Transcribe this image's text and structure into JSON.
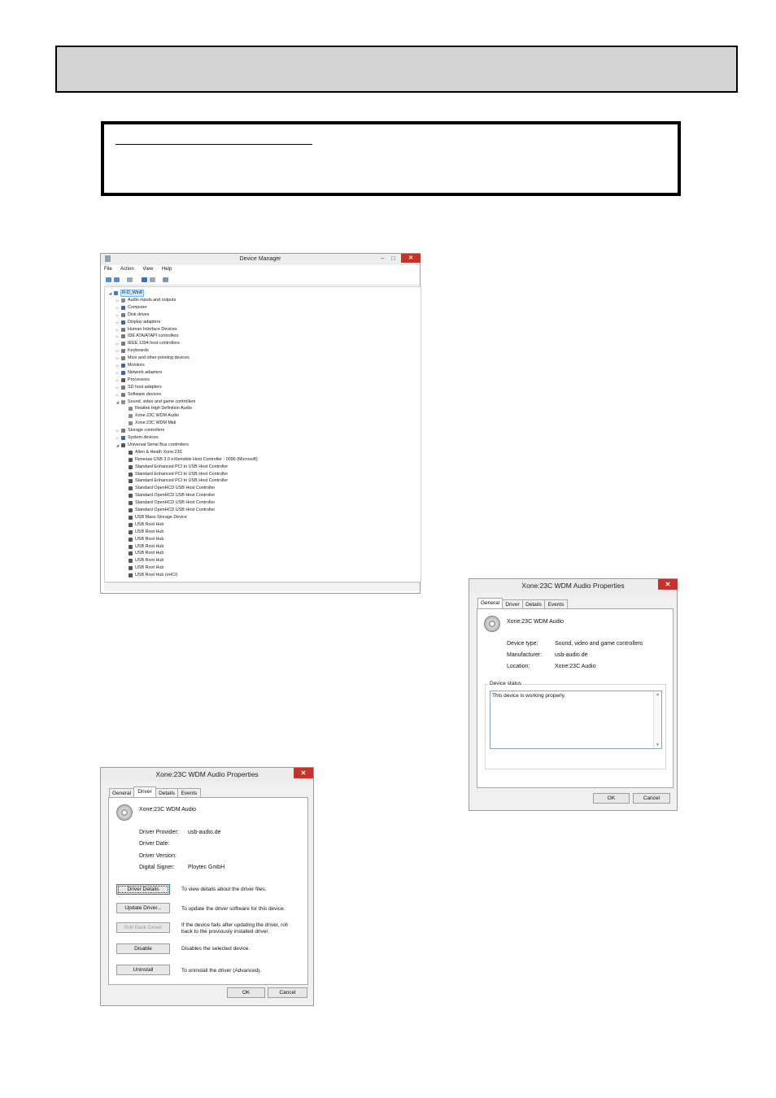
{
  "device_manager": {
    "title": "Device Manager",
    "menu": [
      "File",
      "Action",
      "View",
      "Help"
    ],
    "tree": [
      {
        "label": "R-D_Win8",
        "level": 0,
        "arrow": "down",
        "icon": "#4a78b5",
        "selected": true
      },
      {
        "label": "Audio inputs and outputs",
        "level": 1,
        "arrow": "right",
        "icon": "#8c8c8c"
      },
      {
        "label": "Computer",
        "level": 1,
        "arrow": "right",
        "icon": "#3a6aa6"
      },
      {
        "label": "Disk drives",
        "level": 1,
        "arrow": "right",
        "icon": "#7a7a7a"
      },
      {
        "label": "Display adapters",
        "level": 1,
        "arrow": "right",
        "icon": "#3a6aa6"
      },
      {
        "label": "Human Interface Devices",
        "level": 1,
        "arrow": "right",
        "icon": "#7a7a7a"
      },
      {
        "label": "IDE ATA/ATAPI controllers",
        "level": 1,
        "arrow": "right",
        "icon": "#7a7a7a"
      },
      {
        "label": "IEEE 1394 host controllers",
        "level": 1,
        "arrow": "right",
        "icon": "#7a7a7a"
      },
      {
        "label": "Keyboards",
        "level": 1,
        "arrow": "right",
        "icon": "#7a7a7a"
      },
      {
        "label": "Mice and other pointing devices",
        "level": 1,
        "arrow": "right",
        "icon": "#7a7a7a"
      },
      {
        "label": "Monitors",
        "level": 1,
        "arrow": "right",
        "icon": "#3a6aa6"
      },
      {
        "label": "Network adapters",
        "level": 1,
        "arrow": "right",
        "icon": "#3a6aa6"
      },
      {
        "label": "Processors",
        "level": 1,
        "arrow": "right",
        "icon": "#555555"
      },
      {
        "label": "SD host adapters",
        "level": 1,
        "arrow": "right",
        "icon": "#7a7a7a"
      },
      {
        "label": "Software devices",
        "level": 1,
        "arrow": "right",
        "icon": "#7a7a7a"
      },
      {
        "label": "Sound, video and game controllers",
        "level": 1,
        "arrow": "down",
        "icon": "#8c8c8c"
      },
      {
        "label": "Realtek High Definition Audio",
        "level": 2,
        "arrow": "",
        "icon": "#8c8c8c"
      },
      {
        "label": "Xone:23C WDM Audio",
        "level": 2,
        "arrow": "",
        "icon": "#8c8c8c"
      },
      {
        "label": "Xone:23C WDM Midi",
        "level": 2,
        "arrow": "",
        "icon": "#8c8c8c"
      },
      {
        "label": "Storage controllers",
        "level": 1,
        "arrow": "right",
        "icon": "#7a7a7a"
      },
      {
        "label": "System devices",
        "level": 1,
        "arrow": "right",
        "icon": "#3a6aa6"
      },
      {
        "label": "Universal Serial Bus controllers",
        "level": 1,
        "arrow": "down",
        "icon": "#555555"
      },
      {
        "label": "Allen & Heath Xone:23C",
        "level": 2,
        "arrow": "",
        "icon": "#555555"
      },
      {
        "label": "Renesas USB 3.0 eXtensible Host Controller - 0096 (Microsoft)",
        "level": 2,
        "arrow": "",
        "icon": "#555555"
      },
      {
        "label": "Standard Enhanced PCI to USB Host Controller",
        "level": 2,
        "arrow": "",
        "icon": "#555555"
      },
      {
        "label": "Standard Enhanced PCI to USB Host Controller",
        "level": 2,
        "arrow": "",
        "icon": "#555555"
      },
      {
        "label": "Standard Enhanced PCI to USB Host Controller",
        "level": 2,
        "arrow": "",
        "icon": "#555555"
      },
      {
        "label": "Standard OpenHCD USB Host Controller",
        "level": 2,
        "arrow": "",
        "icon": "#555555"
      },
      {
        "label": "Standard OpenHCD USB Host Controller",
        "level": 2,
        "arrow": "",
        "icon": "#555555"
      },
      {
        "label": "Standard OpenHCD USB Host Controller",
        "level": 2,
        "arrow": "",
        "icon": "#555555"
      },
      {
        "label": "Standard OpenHCD USB Host Controller",
        "level": 2,
        "arrow": "",
        "icon": "#555555"
      },
      {
        "label": "USB Mass Storage Device",
        "level": 2,
        "arrow": "",
        "icon": "#555555"
      },
      {
        "label": "USB Root Hub",
        "level": 2,
        "arrow": "",
        "icon": "#555555"
      },
      {
        "label": "USB Root Hub",
        "level": 2,
        "arrow": "",
        "icon": "#555555"
      },
      {
        "label": "USB Root Hub",
        "level": 2,
        "arrow": "",
        "icon": "#555555"
      },
      {
        "label": "USB Root Hub",
        "level": 2,
        "arrow": "",
        "icon": "#555555"
      },
      {
        "label": "USB Root Hub",
        "level": 2,
        "arrow": "",
        "icon": "#555555"
      },
      {
        "label": "USB Root Hub",
        "level": 2,
        "arrow": "",
        "icon": "#555555"
      },
      {
        "label": "USB Root Hub",
        "level": 2,
        "arrow": "",
        "icon": "#555555"
      },
      {
        "label": "USB Root Hub (xHCI)",
        "level": 2,
        "arrow": "",
        "icon": "#555555"
      }
    ]
  },
  "general_dialog": {
    "title": "Xone:23C WDM Audio Properties",
    "tabs": [
      "General",
      "Driver",
      "Details",
      "Events"
    ],
    "active_tab": "General",
    "device_name": "Xone:23C WDM Audio",
    "device_type_label": "Device type:",
    "device_type_value": "Sound, video and game controllers",
    "manufacturer_label": "Manufacturer:",
    "manufacturer_value": "usb-audio.de",
    "location_label": "Location:",
    "location_value": "Xone:23C Audio",
    "status_group": "Device status",
    "status_text": "This device is working properly.",
    "ok": "OK",
    "cancel": "Cancel"
  },
  "driver_dialog": {
    "title": "Xone:23C WDM Audio Properties",
    "tabs": [
      "General",
      "Driver",
      "Details",
      "Events"
    ],
    "active_tab": "Driver",
    "device_name": "Xone:23C WDM Audio",
    "provider_label": "Driver Provider:",
    "provider_value": "usb-audio.de",
    "date_label": "Driver Date:",
    "version_label": "Driver Version:",
    "signer_label": "Digital Signer:",
    "signer_value": "Ploytec GmbH",
    "details_btn": "Driver Details",
    "details_desc": "To view details about the driver files.",
    "update_btn": "Update Driver...",
    "update_desc": "To update the driver software for this device.",
    "rollback_btn": "Roll Back Driver",
    "rollback_desc1": "If the device fails after updating the driver, roll",
    "rollback_desc2": "back to the previously installed driver.",
    "disable_btn": "Disable",
    "disable_desc": "Disables the selected device.",
    "uninstall_btn": "Uninstall",
    "uninstall_desc": "To uninstall the driver (Advanced).",
    "ok": "OK",
    "cancel": "Cancel"
  },
  "colors": {
    "header_bar": "#d4d4d4",
    "close_button": "#c7332c",
    "selection": "#cde8ff"
  }
}
